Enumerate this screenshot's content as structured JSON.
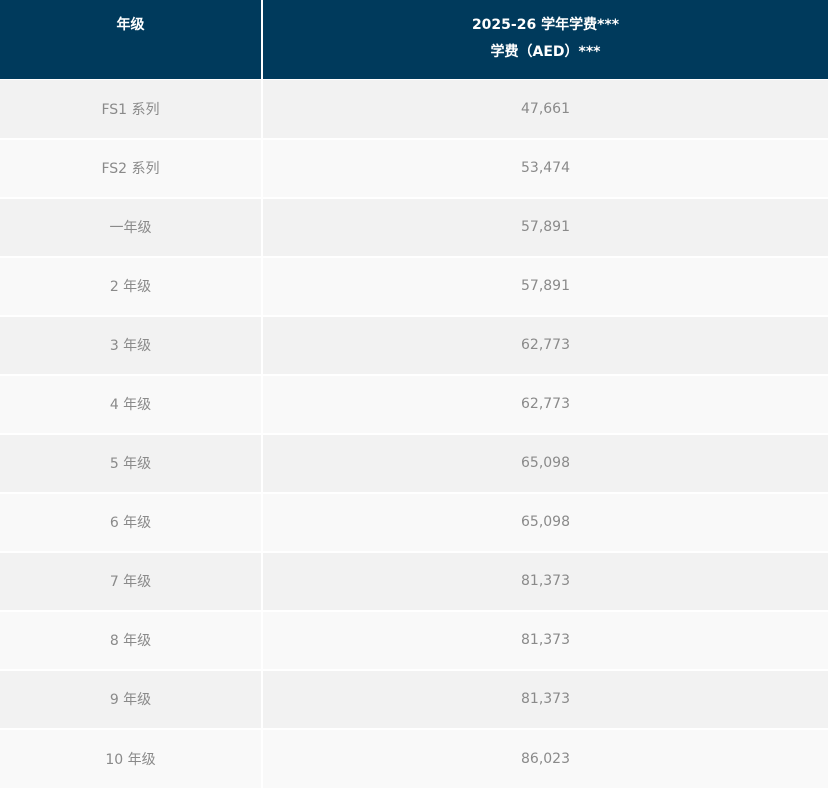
{
  "header": {
    "grade_label": "年级",
    "fee_title_line1": "2025-26 学年学费***",
    "fee_title_line2": "学费（AED）***"
  },
  "rows": [
    {
      "grade": "FS1 系列",
      "fee": "47,661"
    },
    {
      "grade": "FS2 系列",
      "fee": "53,474"
    },
    {
      "grade": "一年级",
      "fee": "57,891"
    },
    {
      "grade": "2 年级",
      "fee": "57,891"
    },
    {
      "grade": "3 年级",
      "fee": "62,773"
    },
    {
      "grade": "4 年级",
      "fee": "62,773"
    },
    {
      "grade": "5 年级",
      "fee": "65,098"
    },
    {
      "grade": "6 年级",
      "fee": "65,098"
    },
    {
      "grade": "7 年级",
      "fee": "81,373"
    },
    {
      "grade": "8 年级",
      "fee": "81,373"
    },
    {
      "grade": "9 年级",
      "fee": "81,373"
    },
    {
      "grade": "10 年级",
      "fee": "86,023"
    }
  ],
  "colors": {
    "header_bg": "#003a5c",
    "row_odd_bg": "#f2f2f2",
    "row_even_bg": "#f9f9f9",
    "cell_text": "#8a8a8a"
  }
}
